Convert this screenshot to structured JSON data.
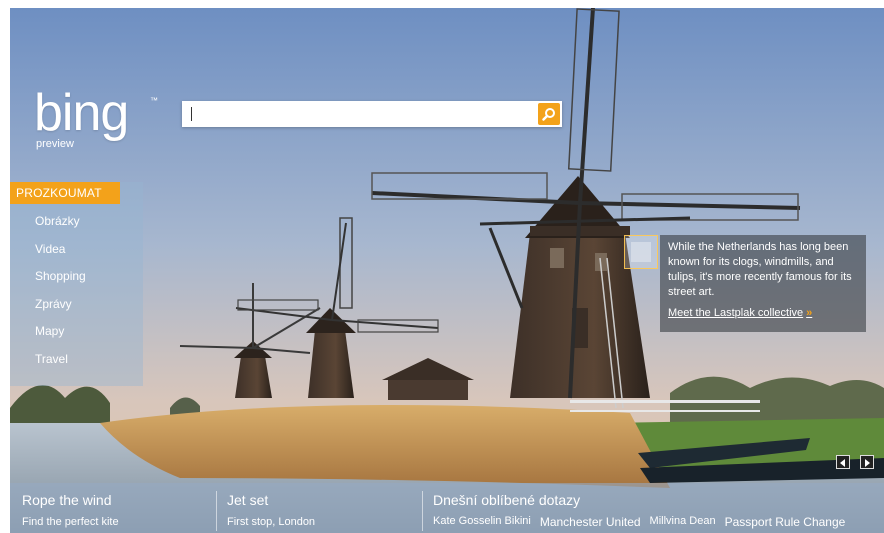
{
  "brand": {
    "logo": "bing",
    "logo_mark": "™",
    "subtitle": "preview"
  },
  "search": {
    "value": "",
    "placeholder": ""
  },
  "explore": {
    "heading": "PROZKOUMAT",
    "items": [
      {
        "label": "Obrázky"
      },
      {
        "label": "Videa"
      },
      {
        "label": "Shopping"
      },
      {
        "label": "Zprávy"
      },
      {
        "label": "Mapy"
      },
      {
        "label": "Travel"
      }
    ]
  },
  "info_box": {
    "text": "While the Netherlands has long been known for its clogs, windmills, and tulips, it's more recently famous for its street art.",
    "link": "Meet the Lastplak collective",
    "link_arrow": "»"
  },
  "bottom": {
    "col1": {
      "title": "Rope the wind",
      "subtitle": "Find the perfect kite"
    },
    "col2": {
      "title": "Jet set",
      "subtitle": "First stop, London"
    },
    "col3": {
      "title": "Dnešní oblíbené dotazy",
      "queries": [
        "Kate Gosselin Bikini",
        "Manchester United",
        "Millvina Dean",
        "Passport Rule Change"
      ]
    }
  },
  "colors": {
    "accent": "#f3a21a",
    "sky_top": "#6e8fc2",
    "sky_bottom": "#d8c6bb",
    "reeds": "#c99a5a",
    "grass": "#5f8a3a"
  },
  "icons": {
    "search": "magnifier-icon",
    "prev": "triangle-left-icon",
    "next": "triangle-right-icon"
  }
}
